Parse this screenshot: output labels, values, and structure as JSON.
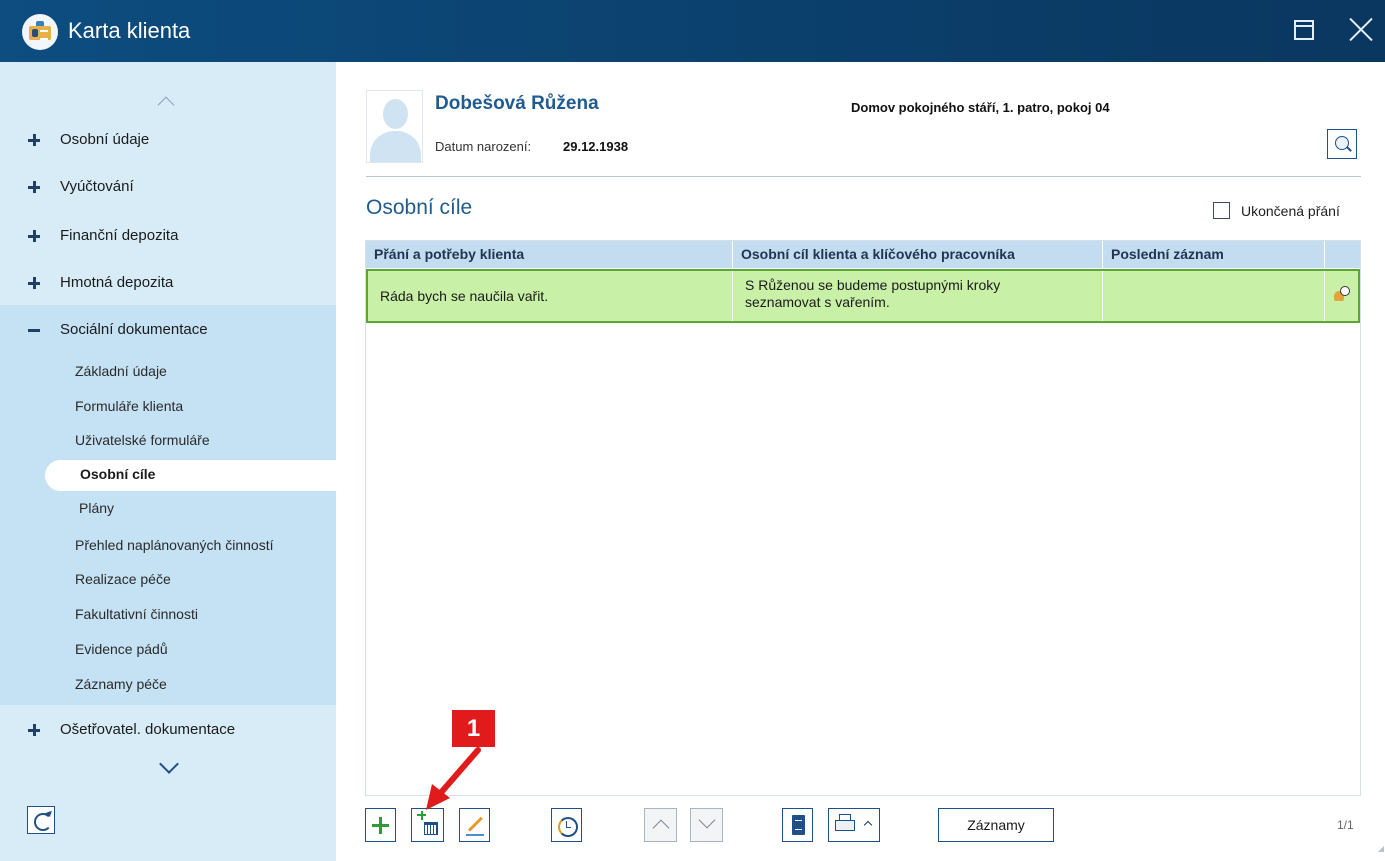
{
  "window": {
    "title": "Karta klienta"
  },
  "sidebar": {
    "groups_top": [
      {
        "label": "Osobní údaje",
        "expanded": false
      },
      {
        "label": "Vyúčtování",
        "expanded": false
      },
      {
        "label": "Finanční depozita",
        "expanded": false
      },
      {
        "label": "Hmotná depozita",
        "expanded": false
      },
      {
        "label": "Sociální dokumentace",
        "expanded": true
      }
    ],
    "sub_items": [
      "Základní údaje",
      "Formuláře klienta",
      "Uživatelské formuláře",
      "Osobní cíle",
      "Plány",
      "Přehled naplánovaných činností",
      "Realizace péče",
      "Fakultativní činnosti",
      "Evidence pádů",
      "Záznamy péče"
    ],
    "active_sub_item": "Osobní cíle",
    "groups_bottom": [
      {
        "label": "Ošetřovatel. dokumentace",
        "expanded": false
      }
    ]
  },
  "client": {
    "name": "Dobešová Růžena",
    "birth_label": "Datum narození:",
    "birth_date": "29.12.1938",
    "location": "Domov pokojného stáří, 1. patro, pokoj 04"
  },
  "section": {
    "title": "Osobní cíle",
    "checkbox_label": "Ukončená přání",
    "checkbox_checked": false
  },
  "table": {
    "columns": [
      "Přání a potřeby klienta",
      "Osobní cíl klienta a klíčového pracovníka",
      "Poslední záznam"
    ],
    "rows": [
      {
        "wish": "Ráda bych se naučila vařit.",
        "goal_line1": "S Růženou se budeme postupnými kroky",
        "goal_line2": "seznamovat s vařením.",
        "last_record": ""
      }
    ]
  },
  "toolbar": {
    "records_label": "Záznamy",
    "pager": "1/1"
  },
  "annotation": {
    "label": "1"
  },
  "colors": {
    "titlebar": "#0b3f6b",
    "sidebar": "#d8ecf8",
    "selected_row": "#c9f0a7",
    "accent": "#1f5c8f",
    "annotation": "#e11b1b"
  }
}
